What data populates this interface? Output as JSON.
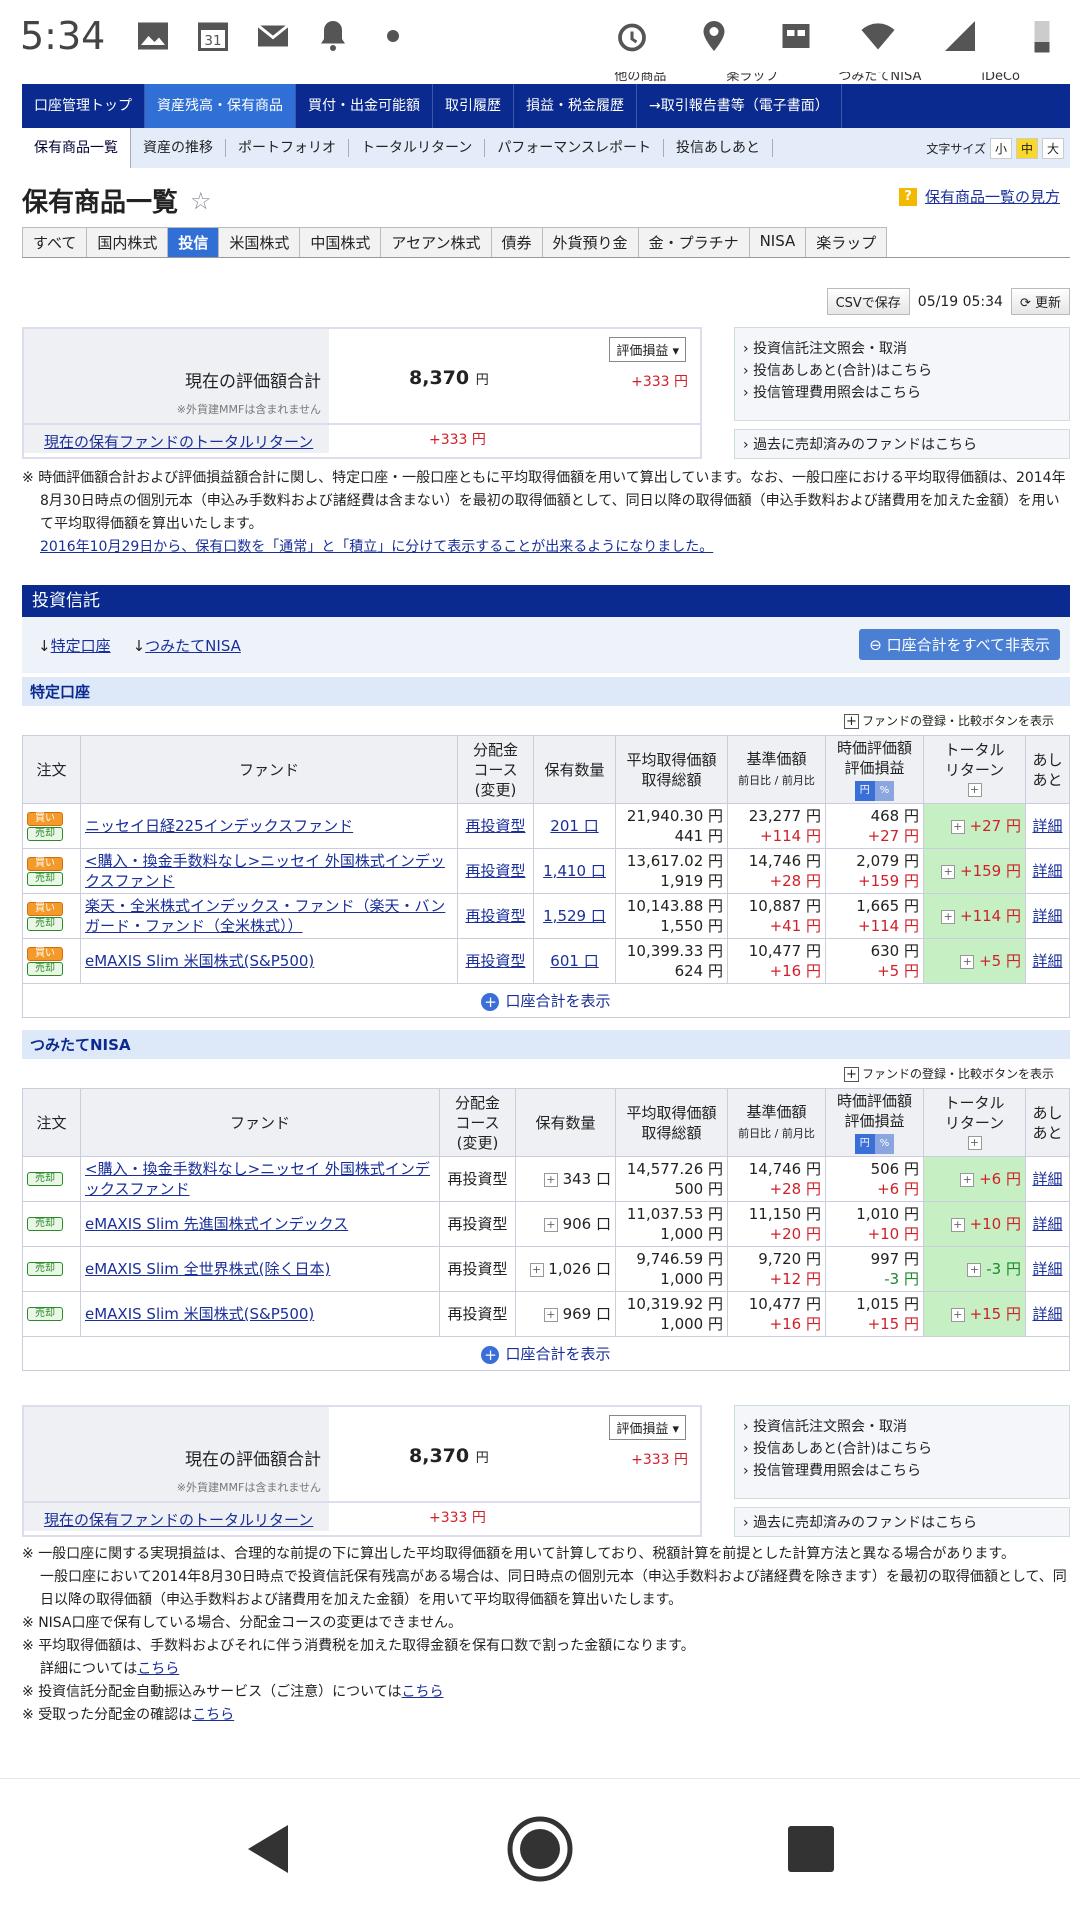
{
  "status_bar": {
    "time": "5:34",
    "calendar_day": "31"
  },
  "top_cut": [
    "他の商品",
    "楽ラップ",
    "つみたてNISA",
    "iDeCo"
  ],
  "main_nav": [
    "口座管理トップ",
    "資産残高・保有商品",
    "買付・出金可能額",
    "取引履歴",
    "損益・税金履歴",
    "→取引報告書等（電子書面）"
  ],
  "sub_nav": [
    "保有商品一覧",
    "資産の推移",
    "ポートフォリオ",
    "トータルリターン",
    "パフォーマンスレポート",
    "投信あしあと"
  ],
  "font_size": {
    "label": "文字サイズ",
    "small": "小",
    "mid": "中",
    "large": "大"
  },
  "title": "保有商品一覧",
  "howto_link": "保有商品一覧の見方",
  "tabs": [
    "すべて",
    "国内株式",
    "投信",
    "米国株式",
    "中国株式",
    "アセアン株式",
    "債券",
    "外貨預り金",
    "金・プラチナ",
    "NISA",
    "楽ラップ"
  ],
  "csv_button": "CSVで保存",
  "datetime": "05/19 05:34",
  "refresh_button": "更新",
  "summary": {
    "label": "現在の評価額合計",
    "note": "※外貨建MMFは含まれません",
    "amount": "8,370",
    "yen": "円",
    "select": "評価損益",
    "pl": "+333 円",
    "return_label": "現在の保有ファンドのトータルリターン",
    "return_value": "+333 円"
  },
  "side_links": [
    "投資信託注文照会・取消",
    "投信あしあと(合計)はこちら",
    "投信管理費用照会はこちら"
  ],
  "side_link_past": "過去に売却済みのファンドはこちら",
  "note1": "時価評価額合計および評価損益額合計に関し、特定口座・一般口座ともに平均取得価額を用いて算出しています。なお、一般口座における平均取得価額は、2014年8月30日時点の個別元本（申込み手数料および諸経費は含まない）を最初の取得価額として、同日以降の取得価額（申込手数料および諸費用を加えた金額）を用いて平均取得価額を算出いたします。",
  "note1_link": "2016年10月29日から、保有口数を「通常」と「積立」に分けて表示することが出来るようになりました。",
  "section_title": "投資信託",
  "anchors": [
    "特定口座",
    "つみたてNISA"
  ],
  "hide_all_button": "口座合計をすべて非表示",
  "add_button": "ファンドの登録・比較ボタンを表示",
  "headers": {
    "order": "注文",
    "fund": "ファンド",
    "course": [
      "分配金",
      "コース",
      "(変更)"
    ],
    "qty": "保有数量",
    "avg": [
      "平均取得価額",
      "取得総額"
    ],
    "base": [
      "基準価額",
      "前日比 / 前月比"
    ],
    "eval": [
      "時価評価額",
      "評価損益"
    ],
    "unit_yen": "円",
    "unit_pct": "%",
    "total": [
      "トータル",
      "リターン"
    ],
    "ashi": [
      "あし",
      "あと"
    ]
  },
  "buy_label": "買い",
  "sell_label": "売却",
  "tokutei": {
    "title": "特定口座",
    "rows": [
      {
        "fund": "ニッセイ日経225インデックスファンド",
        "course": "再投資型",
        "qty": "201 口",
        "avg": "21,940.30 円",
        "cost": "441 円",
        "base": "23,277 円",
        "diff": "+114 円",
        "eval": "468 円",
        "pl": "+27 円",
        "total": "+27 円",
        "detail": "詳細"
      },
      {
        "fund": "<購入・換金手数料なし>ニッセイ 外国株式インデックスファンド",
        "course": "再投資型",
        "qty": "1,410 口",
        "avg": "13,617.02 円",
        "cost": "1,919 円",
        "base": "14,746 円",
        "diff": "+28 円",
        "eval": "2,079 円",
        "pl": "+159 円",
        "total": "+159 円",
        "detail": "詳細"
      },
      {
        "fund": "楽天・全米株式インデックス・ファンド（楽天・バンガード・ファンド（全米株式））",
        "course": "再投資型",
        "qty": "1,529 口",
        "avg": "10,143.88 円",
        "cost": "1,550 円",
        "base": "10,887 円",
        "diff": "+41 円",
        "eval": "1,665 円",
        "pl": "+114 円",
        "total": "+114 円",
        "detail": "詳細"
      },
      {
        "fund": "eMAXIS Slim 米国株式(S&P500)",
        "course": "再投資型",
        "qty": "601 口",
        "avg": "10,399.33 円",
        "cost": "624 円",
        "base": "10,477 円",
        "diff": "+16 円",
        "eval": "630 円",
        "pl": "+5 円",
        "total": "+5 円",
        "detail": "詳細"
      }
    ],
    "show_total": "口座合計を表示"
  },
  "nisa": {
    "title": "つみたてNISA",
    "rows": [
      {
        "fund": "<購入・換金手数料なし>ニッセイ 外国株式インデックスファンド",
        "course": "再投資型",
        "qty": "343 口",
        "avg": "14,577.26 円",
        "cost": "500 円",
        "base": "14,746 円",
        "diff": "+28 円",
        "eval": "506 円",
        "pl": "+6 円",
        "total": "+6 円",
        "detail": "詳細",
        "neg": false
      },
      {
        "fund": "eMAXIS Slim 先進国株式インデックス",
        "course": "再投資型",
        "qty": "906 口",
        "avg": "11,037.53 円",
        "cost": "1,000 円",
        "base": "11,150 円",
        "diff": "+20 円",
        "eval": "1,010 円",
        "pl": "+10 円",
        "total": "+10 円",
        "detail": "詳細",
        "neg": false
      },
      {
        "fund": "eMAXIS Slim 全世界株式(除く日本)",
        "course": "再投資型",
        "qty": "1,026 口",
        "avg": "9,746.59 円",
        "cost": "1,000 円",
        "base": "9,720 円",
        "diff": "+12 円",
        "eval": "997 円",
        "pl": "-3 円",
        "total": "-3 円",
        "detail": "詳細",
        "neg": true
      },
      {
        "fund": "eMAXIS Slim 米国株式(S&P500)",
        "course": "再投資型",
        "qty": "969 口",
        "avg": "10,319.92 円",
        "cost": "1,000 円",
        "base": "10,477 円",
        "diff": "+16 円",
        "eval": "1,015 円",
        "pl": "+15 円",
        "total": "+15 円",
        "detail": "詳細",
        "neg": false
      }
    ],
    "show_total": "口座合計を表示"
  },
  "bottom_notes": [
    "一般口座に関する実現損益は、合理的な前提の下に算出した平均取得価額を用いて計算しており、税額計算を前提とした計算方法と異なる場合があります。",
    "一般口座において2014年8月30日時点で投資信託保有残高がある場合は、同日時点の個別元本（申込手数料および諸経費を除きます）を最初の取得価額として、同日以降の取得価額（申込手数料および諸費用を加えた金額）を用いて平均取得価額を算出いたします。",
    "NISA口座で保有している場合、分配金コースの変更はできません。",
    "平均取得価額は、手数料およびそれに伴う消費税を加えた取得金額を保有口数で割った金額になります。",
    "詳細については",
    "投資信託分配金自動振込みサービス（ご注意）については",
    "受取った分配金の確認は"
  ],
  "here": "こちら"
}
